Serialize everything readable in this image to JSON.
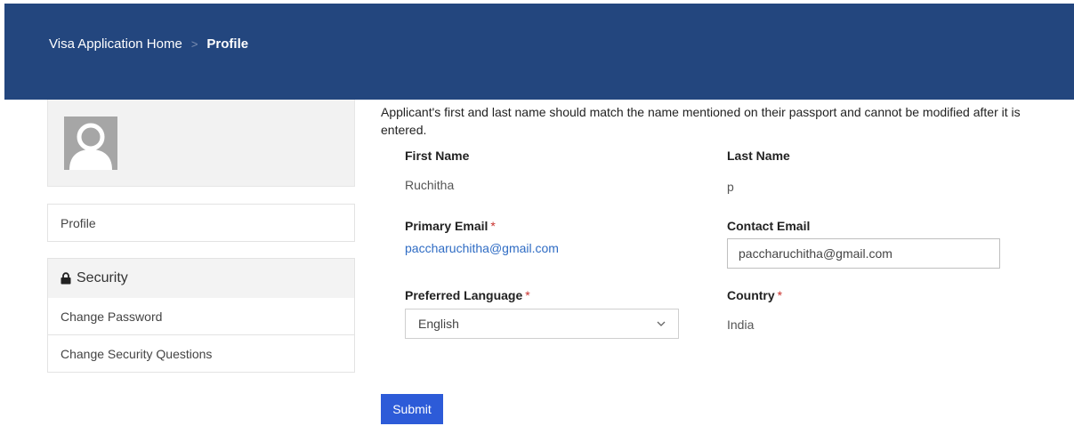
{
  "header": {
    "breadcrumb_home": "Visa Application Home",
    "breadcrumb_separator": ">",
    "breadcrumb_current": "Profile"
  },
  "sidebar": {
    "profile_label": "Profile",
    "security_heading": "Security",
    "change_password_label": "Change Password",
    "change_security_questions_label": "Change Security Questions"
  },
  "form": {
    "intro_text": "Applicant's first and last name should match the name mentioned on their passport and cannot be modified after it is entered.",
    "first_name_label": "First Name",
    "first_name_value": "Ruchitha",
    "last_name_label": "Last Name",
    "last_name_value": "p",
    "primary_email_label": "Primary Email",
    "primary_email_value": "paccharuchitha@gmail.com",
    "contact_email_label": "Contact Email",
    "contact_email_value": "paccharuchitha@gmail.com",
    "preferred_language_label": "Preferred Language",
    "preferred_language_value": "English",
    "country_label": "Country",
    "country_value": "India",
    "required_marker": "*",
    "submit_label": "Submit"
  },
  "colors": {
    "header_bg": "#23467e",
    "submit_bg": "#2d5bd8",
    "link": "#2f6cc4",
    "required": "#c9302c"
  },
  "icons": {
    "avatar": "user-placeholder-icon",
    "security": "lock-icon",
    "select": "chevron-down-icon"
  }
}
